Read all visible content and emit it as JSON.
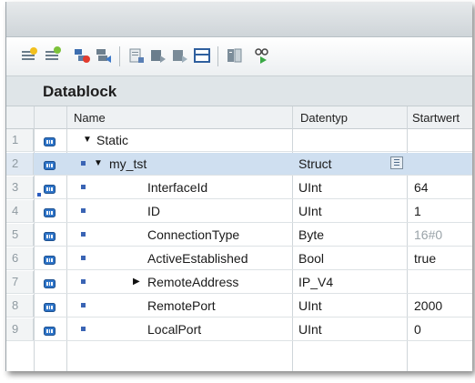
{
  "title": "Datablock",
  "columns": {
    "name": "Name",
    "datatype": "Datentyp",
    "start": "Startwert"
  },
  "toolbar": {
    "icons": [
      "insert-row-icon",
      "add-row-icon",
      "expand-icon",
      "collapse-icon",
      "snapshot-icon",
      "copy-snapshot-icon",
      "load-snapshot-icon",
      "monitor-value-icon",
      "keep-actual-values-icon",
      "monitor-all-icon"
    ]
  },
  "rows": [
    {
      "num": "1",
      "name": "Static",
      "datatype": "",
      "start": "",
      "indent": 0,
      "expander": "down",
      "bullet": false
    },
    {
      "num": "2",
      "name": "my_tst",
      "datatype": "Struct",
      "start": "",
      "indent": 1,
      "expander": "down",
      "bullet": true,
      "selected": true
    },
    {
      "num": "3",
      "name": "InterfaceId",
      "datatype": "UInt",
      "start": "64",
      "indent": 2,
      "expander": "",
      "bullet": true
    },
    {
      "num": "4",
      "name": "ID",
      "datatype": "UInt",
      "start": "1",
      "indent": 2,
      "expander": "",
      "bullet": true
    },
    {
      "num": "5",
      "name": "ConnectionType",
      "datatype": "Byte",
      "start": "16#0",
      "indent": 2,
      "expander": "",
      "bullet": true,
      "start_muted": true
    },
    {
      "num": "6",
      "name": "ActiveEstablished",
      "datatype": "Bool",
      "start": "true",
      "indent": 2,
      "expander": "",
      "bullet": true
    },
    {
      "num": "7",
      "name": "RemoteAddress",
      "datatype": "IP_V4",
      "start": "",
      "indent": 2,
      "expander": "right",
      "bullet": true
    },
    {
      "num": "8",
      "name": "RemotePort",
      "datatype": "UInt",
      "start": "2000",
      "indent": 2,
      "expander": "",
      "bullet": true
    },
    {
      "num": "9",
      "name": "LocalPort",
      "datatype": "UInt",
      "start": "0",
      "indent": 2,
      "expander": "",
      "bullet": true
    }
  ]
}
